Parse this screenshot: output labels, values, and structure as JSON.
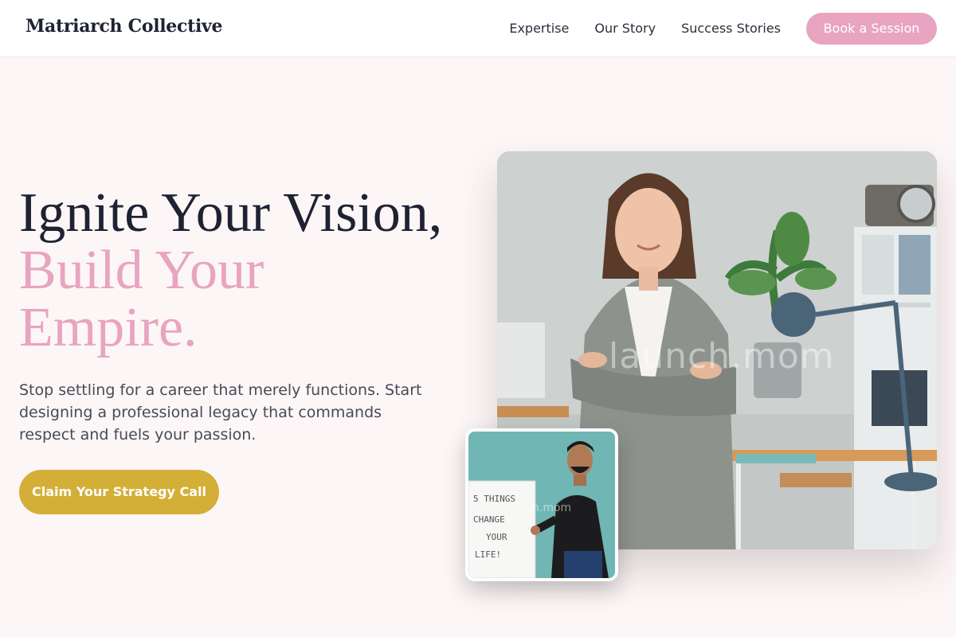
{
  "header": {
    "brand": "Matriarch Collective",
    "nav": [
      "Expertise",
      "Our Story",
      "Success Stories"
    ],
    "cta_label": "Book a Session"
  },
  "hero": {
    "headline_line1": "Ignite Your Vision,",
    "headline_line2": "Build Your",
    "headline_line3": "Empire.",
    "subtext": "Stop settling for a career that merely functions. Start designing a professional legacy that commands respect and fuels your passion.",
    "cta_label": "Claim Your Strategy Call"
  },
  "images": {
    "main_watermark": "launch.mom",
    "inset_watermark": "h.mom",
    "whiteboard_lines": [
      "5 THINGS",
      "CHANGE",
      "YOUR",
      "LIFE!"
    ]
  },
  "colors": {
    "accent_pink": "#e8a4c0",
    "accent_gold": "#d4af37",
    "ink": "#1e2233",
    "background": "#fdf6f6"
  }
}
